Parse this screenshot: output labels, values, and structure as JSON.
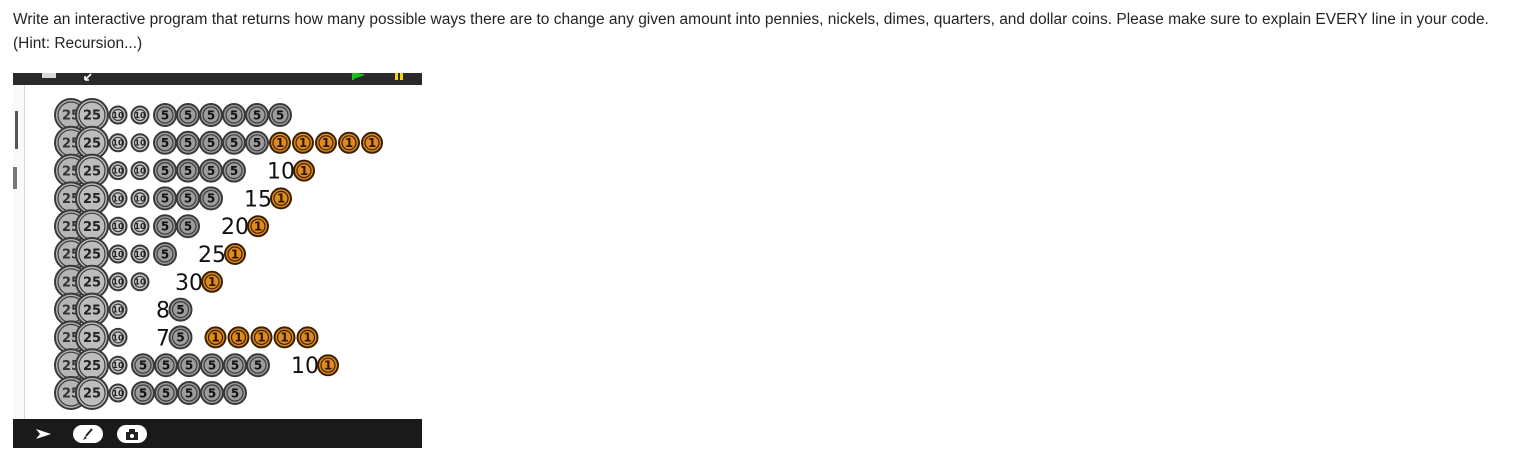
{
  "question": {
    "text": "Write an interactive program that returns how many possible ways there are to change any given amount into pennies, nickels, dimes, quarters, and dollar coins. Please make sure to explain EVERY line in your code. (Hint: Recursion...)"
  },
  "stage": {
    "toolbar_icons": [
      "pointer-arrow-icon",
      "paintbrush-icon",
      "camera-icon"
    ],
    "top_icons": [
      "stage-menu-icon",
      "shrink-arrow-icon",
      "green-flag-icon",
      "pause-icon"
    ]
  },
  "coins": {
    "quarter_label": "25",
    "quarter_partial": "25",
    "dime_label": "10",
    "nickel_label": "5",
    "penny_label": "1",
    "colors": {
      "silver_fill": "#a9a9a9",
      "silver_stroke": "#3a3a3a",
      "nickel_fill": "#9c9c9c",
      "penny_fill": "#e08a1b",
      "penny_stroke": "#3a2000"
    }
  },
  "rows": [
    {
      "dimes": 2,
      "nickels": 6,
      "number": "",
      "number_coin": "",
      "pennies": 0
    },
    {
      "dimes": 2,
      "nickels": 5,
      "number": "",
      "number_coin": "",
      "pennies": 5
    },
    {
      "dimes": 2,
      "nickels": 4,
      "number": "10",
      "number_coin": "1",
      "pennies": 0
    },
    {
      "dimes": 2,
      "nickels": 3,
      "number": "15",
      "number_coin": "1",
      "pennies": 0
    },
    {
      "dimes": 2,
      "nickels": 2,
      "number": "20",
      "number_coin": "1",
      "pennies": 0
    },
    {
      "dimes": 2,
      "nickels": 1,
      "number": "25",
      "number_coin": "1",
      "pennies": 0
    },
    {
      "dimes": 2,
      "nickels": 0,
      "number": "30",
      "number_coin": "1",
      "pennies": 0
    },
    {
      "dimes": 1,
      "nickels": 0,
      "number": "8",
      "number_coin": "5",
      "pennies": 0
    },
    {
      "dimes": 1,
      "nickels": 0,
      "number": "7",
      "number_coin": "5",
      "pennies": 5
    },
    {
      "dimes": 1,
      "nickels": 6,
      "number": "10",
      "number_coin": "1",
      "pennies": 0
    },
    {
      "dimes": 1,
      "nickels": 5,
      "number": "",
      "number_coin": "",
      "pennies": 0
    }
  ]
}
